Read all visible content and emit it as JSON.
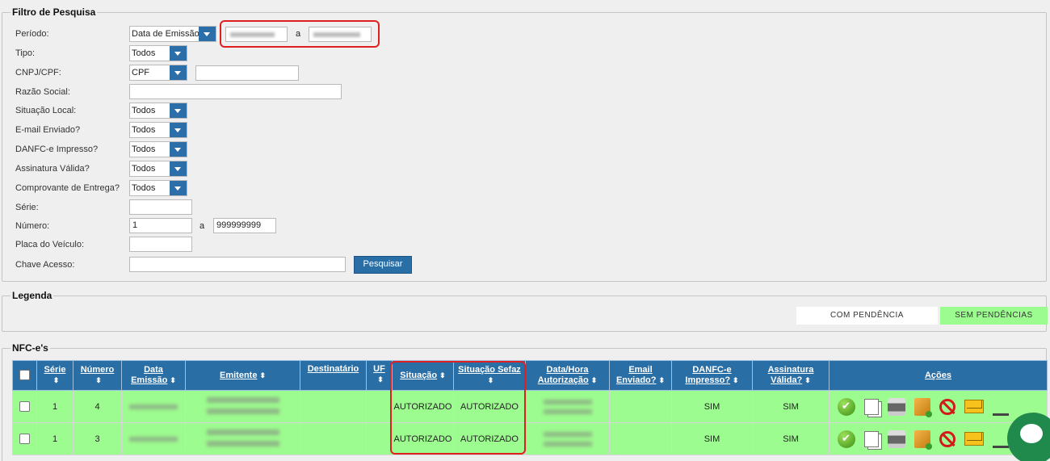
{
  "filter": {
    "legend": "Filtro de Pesquisa",
    "periodo_label": "Período:",
    "periodo_value": "Data de Emissão",
    "periodo_sep": "a",
    "tipo_label": "Tipo:",
    "tipo_value": "Todos",
    "cnpj_label": "CNPJ/CPF:",
    "cnpj_value": "CPF",
    "razao_label": "Razão Social:",
    "situacao_label": "Situação Local:",
    "situacao_value": "Todos",
    "email_label": "E-mail Enviado?",
    "email_value": "Todos",
    "danfce_label": "DANFC-e Impresso?",
    "danfce_value": "Todos",
    "assinatura_label": "Assinatura Válida?",
    "assinatura_value": "Todos",
    "comprovante_label": "Comprovante de Entrega?",
    "comprovante_value": "Todos",
    "serie_label": "Série:",
    "numero_label": "Número:",
    "numero_from": "1",
    "numero_sep": "a",
    "numero_to": "999999999",
    "placa_label": "Placa do Veículo:",
    "chave_label": "Chave Acesso:",
    "search_button": "Pesquisar"
  },
  "legenda": {
    "legend": "Legenda",
    "com_pendencia": "COM PENDÊNCIA",
    "sem_pendencias": "SEM PENDÊNCIAS"
  },
  "nfce": {
    "legend": "NFC-e's",
    "headers": {
      "serie": "Série",
      "numero": "Número",
      "data_emissao_1": "Data",
      "data_emissao_2": "Emissão",
      "emitente": "Emitente",
      "destinatario": "Destinatário",
      "uf": "UF",
      "situacao": "Situação",
      "situacao_sefaz": "Situação Sefaz",
      "data_hora_1": "Data/Hora",
      "data_hora_2": "Autorização",
      "email_1": "Email",
      "email_2": "Enviado?",
      "danfce_1": "DANFC-e",
      "danfce_2": "Impresso?",
      "assinatura_1": "Assinatura",
      "assinatura_2": "Válida?",
      "acoes": "Ações"
    },
    "rows": [
      {
        "serie": "1",
        "numero": "4",
        "situacao": "AUTORIZADO",
        "situacao_sefaz": "AUTORIZADO",
        "danfce": "SIM",
        "assinatura": "SIM"
      },
      {
        "serie": "1",
        "numero": "3",
        "situacao": "AUTORIZADO",
        "situacao_sefaz": "AUTORIZADO",
        "danfce": "SIM",
        "assinatura": "SIM"
      }
    ]
  },
  "colors": {
    "header_blue": "#2a6ea6",
    "row_green": "#9dfc8f",
    "highlight_red": "#e02020"
  }
}
